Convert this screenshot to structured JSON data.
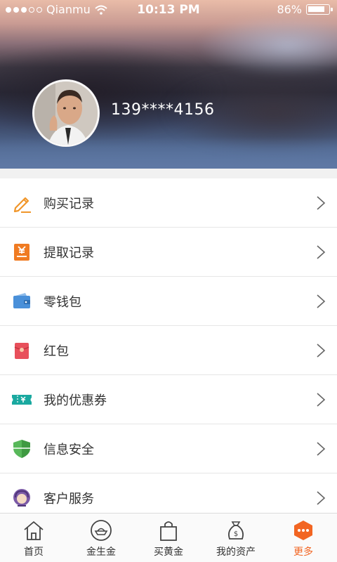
{
  "status_bar": {
    "carrier": "Qianmu",
    "time": "10:13 PM",
    "battery": "86%",
    "battery_level": 0.86
  },
  "profile": {
    "phone": "139****4156"
  },
  "menu": {
    "items": [
      {
        "label": "购买记录",
        "icon": "pencil-icon"
      },
      {
        "label": "提取记录",
        "icon": "yuan-doc-icon"
      },
      {
        "label": "零钱包",
        "icon": "wallet-icon"
      },
      {
        "label": "红包",
        "icon": "red-envelope-icon"
      },
      {
        "label": "我的优惠券",
        "icon": "coupon-icon"
      },
      {
        "label": "信息安全",
        "icon": "shield-icon"
      },
      {
        "label": "客户服务",
        "icon": "customer-service-icon"
      }
    ]
  },
  "tabbar": {
    "tabs": [
      {
        "label": "首页",
        "icon": "home-icon"
      },
      {
        "label": "金生金",
        "icon": "gold-ingot-icon"
      },
      {
        "label": "买黄金",
        "icon": "shopping-bag-icon"
      },
      {
        "label": "我的资产",
        "icon": "money-bag-icon"
      },
      {
        "label": "更多",
        "icon": "more-icon"
      }
    ],
    "active": "更多"
  },
  "colors": {
    "accent": "#f26522",
    "separator": "#e6e6e6",
    "background": "#f1f1f1"
  }
}
